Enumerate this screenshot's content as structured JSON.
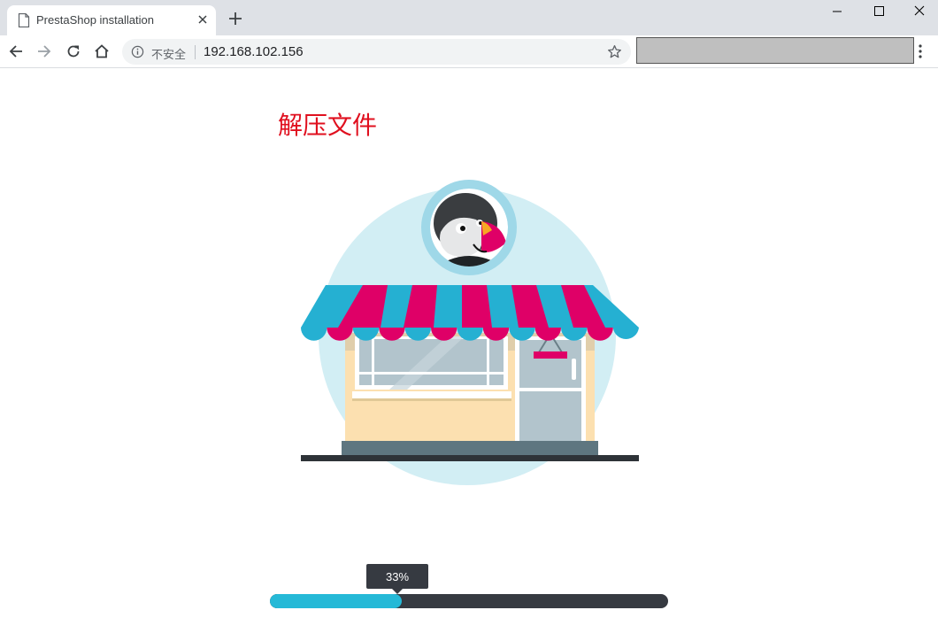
{
  "browser": {
    "tab": {
      "title": "PrestaShop installation"
    },
    "address_bar": {
      "security_label": "不安全",
      "url": "192.168.102.156"
    }
  },
  "installer": {
    "step_title": "解压文件",
    "progress": {
      "value": 0.33,
      "label": "33%"
    }
  },
  "colors": {
    "accent": "#25b9d7",
    "title_red": "#e0101f",
    "progress_track": "#363a41"
  },
  "icons": {
    "tab": [
      "page-icon",
      "close-icon",
      "plus-icon"
    ],
    "window": [
      "minimize-icon",
      "maximize-icon",
      "close-icon"
    ],
    "toolbar": [
      "back-arrow-icon",
      "forward-arrow-icon",
      "reload-icon",
      "home-icon",
      "info-icon",
      "star-icon",
      "more-vertical-icon"
    ]
  }
}
